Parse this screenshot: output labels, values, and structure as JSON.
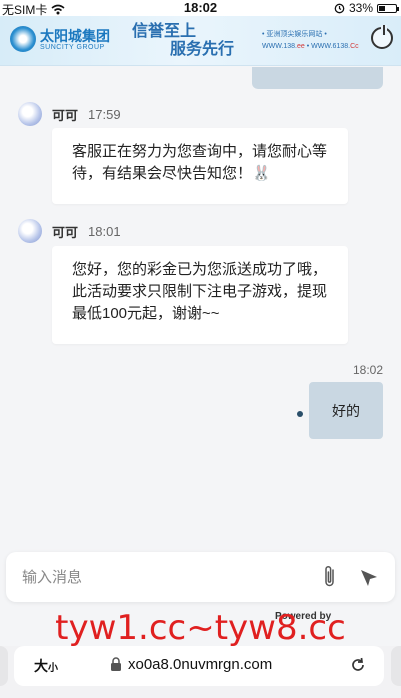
{
  "status_bar": {
    "carrier": "无SIM卡",
    "time": "18:02",
    "battery": "33%"
  },
  "banner": {
    "brand_cn": "太阳城集团",
    "brand_en": "SUNCITY GROUP",
    "slogan_1": "信誉至上",
    "slogan_2": "服务先行",
    "site_line_1": "• 亚洲顶尖娱乐网站 •",
    "site_line_2_prefix": "WWW.138.",
    "site_line_2_ee": "ee",
    "site_line_2_mid": " • WWW.6138.",
    "site_line_2_cc": "Cc"
  },
  "messages": [
    {
      "sender": "可可",
      "time": "17:59",
      "text": "客服正在努力为您查询中，请您耐心等待，有结果会尽快告知您！🐰"
    },
    {
      "sender": "可可",
      "time": "18:01",
      "text": "您好，您的彩金已为您派送成功了哦，此活动要求只限制下注电子游戏，提现最低100元起，谢谢~~"
    }
  ],
  "sent": {
    "time": "18:02",
    "text": "好的"
  },
  "composer": {
    "placeholder": "输入消息"
  },
  "powered_by": "Powered by",
  "watermark": "tyw1.cc~tyw8.cc",
  "browser": {
    "text_size_big": "大",
    "text_size_small": "小",
    "url": "xo0a8.0nuvmrgn.com"
  },
  "icons": {
    "wifi": "wifi-icon",
    "alarm": "alarm-icon",
    "battery": "battery-icon",
    "power": "power-icon",
    "attach": "paperclip-icon",
    "send": "send-icon",
    "lock": "lock-icon",
    "reload": "reload-icon"
  }
}
